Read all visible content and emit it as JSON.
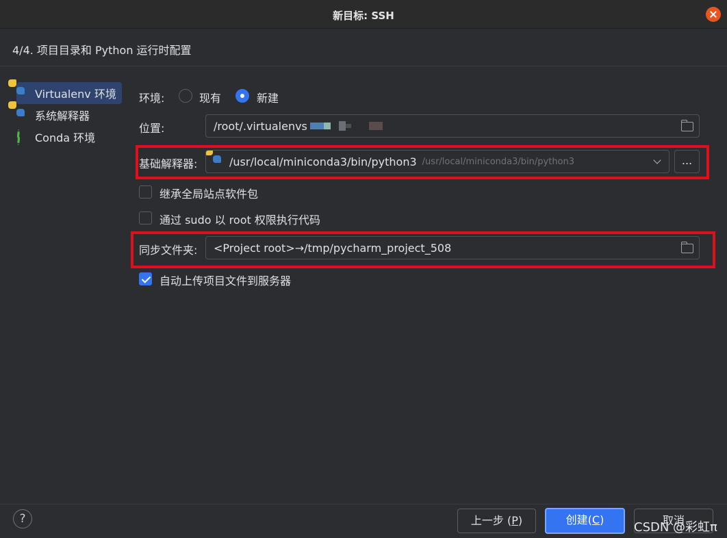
{
  "window": {
    "title": "新目标: SSH"
  },
  "step_title": "4/4. 项目目录和 Python 运行时配置",
  "sidebar": {
    "items": [
      {
        "label": "Virtualenv 环境",
        "icon": "python-icon",
        "selected": true
      },
      {
        "label": "系统解释器",
        "icon": "python-icon",
        "selected": false
      },
      {
        "label": "Conda 环境",
        "icon": "conda-icon",
        "selected": false
      }
    ]
  },
  "env": {
    "label": "环境:",
    "option_existing": "现有",
    "option_new": "新建",
    "selected": "新建"
  },
  "location": {
    "label": "位置:",
    "value": "/root/.virtualenvs"
  },
  "base_interpreter": {
    "label": "基础解释器:",
    "value": "/usr/local/miniconda3/bin/python3",
    "secondary": "/usr/local/miniconda3/bin/python3",
    "browse_label": "..."
  },
  "checkboxes": {
    "inherit": {
      "label": "继承全局站点软件包",
      "checked": false
    },
    "sudo": {
      "label": "通过 sudo 以 root 权限执行代码",
      "checked": false
    },
    "auto_upload": {
      "label": "自动上传项目文件到服务器",
      "checked": true
    }
  },
  "sync_folders": {
    "label": "同步文件夹:",
    "value": "<Project root>→/tmp/pycharm_project_508"
  },
  "footer": {
    "help": "?",
    "prev_label": "上一步 (",
    "prev_mnemonic": "P",
    "prev_end": ")",
    "create_label": "创建(",
    "create_mnemonic": "C",
    "create_end": ")",
    "cancel_label": "取消"
  },
  "watermark": "CSDN @彩虹π",
  "colors": {
    "accent": "#3574f0",
    "highlight_box": "#e0101a",
    "close": "#e9541f"
  }
}
